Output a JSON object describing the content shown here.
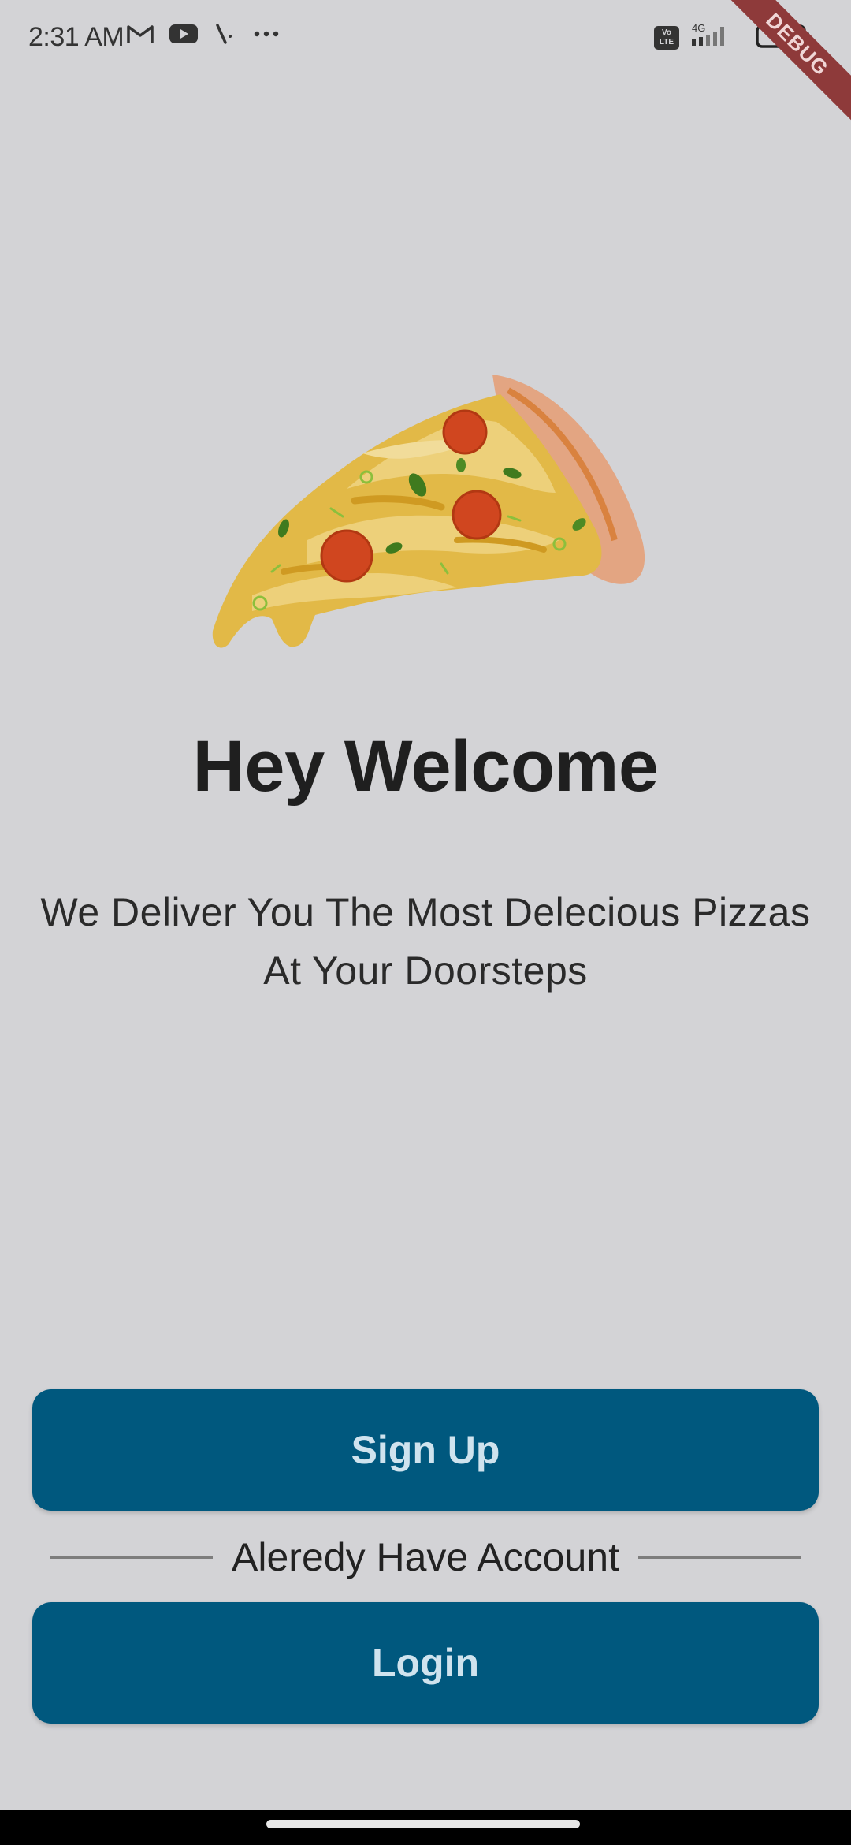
{
  "status_bar": {
    "time": "2:31 AM",
    "left_icons": [
      "gmail-icon",
      "youtube-icon",
      "app-notification-icon",
      "more-icon"
    ],
    "right_icons": [
      "volte-icon",
      "signal-icon",
      "battery-icon"
    ],
    "volte_label": "Vo LTE",
    "network_label": "4G",
    "debug_label": "DEBUG"
  },
  "main": {
    "hero_image": "pizza-slice-icon",
    "title": "Hey Welcome",
    "subtitle": "We Deliver You The Most Delecious Pizzas At Your Doorsteps",
    "signup_label": "Sign Up",
    "divider_label": "Aleredy Have Account",
    "login_label": "Login"
  },
  "colors": {
    "background": "#d3d3d6",
    "primary_button": "#00587e",
    "button_text": "#cfe3ee"
  }
}
